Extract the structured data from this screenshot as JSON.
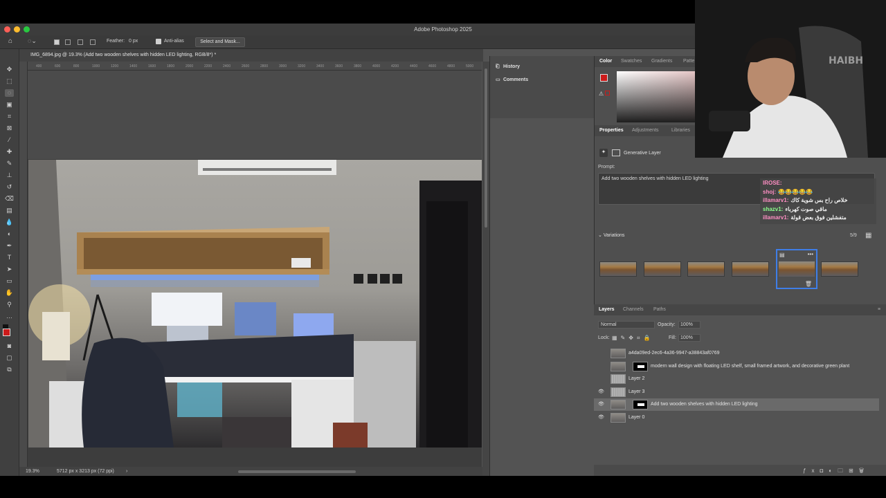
{
  "app": {
    "title": "Adobe Photoshop 2025"
  },
  "options_bar": {
    "feather_label": "Feather:",
    "feather_value": "0 px",
    "anti_alias_label": "Anti-alias",
    "select_mask_label": "Select and Mask..."
  },
  "document": {
    "tab_title": "IMG_6894.jpg @ 19.3% (Add two wooden shelves with hidden LED lighting, RGB/8*) *",
    "ruler_ticks": [
      "400",
      "600",
      "800",
      "1000",
      "1200",
      "1400",
      "1600",
      "1800",
      "2000",
      "2200",
      "2400",
      "2600",
      "2800",
      "3000",
      "3200",
      "3400",
      "3600",
      "3800",
      "4000",
      "4200",
      "4400",
      "4600",
      "4800",
      "5000",
      "5200"
    ],
    "zoom": "19.3%",
    "doc_size": "5712 px x 3213 px (72 ppi)"
  },
  "mid_panel": {
    "history_label": "History",
    "comments_label": "Comments"
  },
  "color_panel": {
    "tabs": [
      "Color",
      "Swatches",
      "Gradients",
      "Patte"
    ],
    "foreground": "#cc1b1b",
    "background": "#ffffff"
  },
  "properties": {
    "tabs": [
      "Properties",
      "Adjustments",
      "Libraries"
    ],
    "type_label": "Generative Layer",
    "prompt_label": "Prompt:",
    "prompt_text": "Add two wooden shelves with hidden LED lighting",
    "variations_label": "Variations",
    "variations_count": "5/9"
  },
  "layers_panel": {
    "tabs": [
      "Layers",
      "Channels",
      "Paths"
    ],
    "blend_mode": "Normal",
    "opacity_label": "Opacity:",
    "opacity_value": "100%",
    "lock_label": "Lock:",
    "fill_label": "Fill:",
    "fill_value": "100%",
    "layers": [
      {
        "name": "a4da09ed-2ec6-4a36-9947-a38843af0769",
        "visible": false,
        "mask": false,
        "thumb": "photo"
      },
      {
        "name": "modern wall design with floating LED shelf, small framed artwork, and decorative green plant",
        "visible": false,
        "mask": true,
        "thumb": "photo"
      },
      {
        "name": "Layer 2",
        "visible": false,
        "mask": false,
        "thumb": "transparent"
      },
      {
        "name": "Layer 3",
        "visible": true,
        "mask": false,
        "thumb": "transparent"
      },
      {
        "name": "Add two wooden shelves with hidden LED lighting",
        "visible": true,
        "mask": true,
        "thumb": "photo",
        "selected": true
      },
      {
        "name": "Layer 0",
        "visible": true,
        "mask": false,
        "thumb": "photo"
      }
    ]
  },
  "chat_overlay": [
    {
      "user": "lROSE:",
      "msg": "",
      "color": "pink"
    },
    {
      "user": "shoj:",
      "msg": "😂😂😂😂😂",
      "color": "pink"
    },
    {
      "user": "illamarv1:",
      "msg": "خلاص راح بس شوية كاك",
      "color": "pink"
    },
    {
      "user": "shazv1:",
      "msg": "ماقي صوت كهرباء",
      "color": "green"
    },
    {
      "user": "illamarv1:",
      "msg": "متفشلين فوق بعض قولة",
      "color": "pink"
    }
  ],
  "webcam": {
    "chair_brand": "HAIBH"
  }
}
